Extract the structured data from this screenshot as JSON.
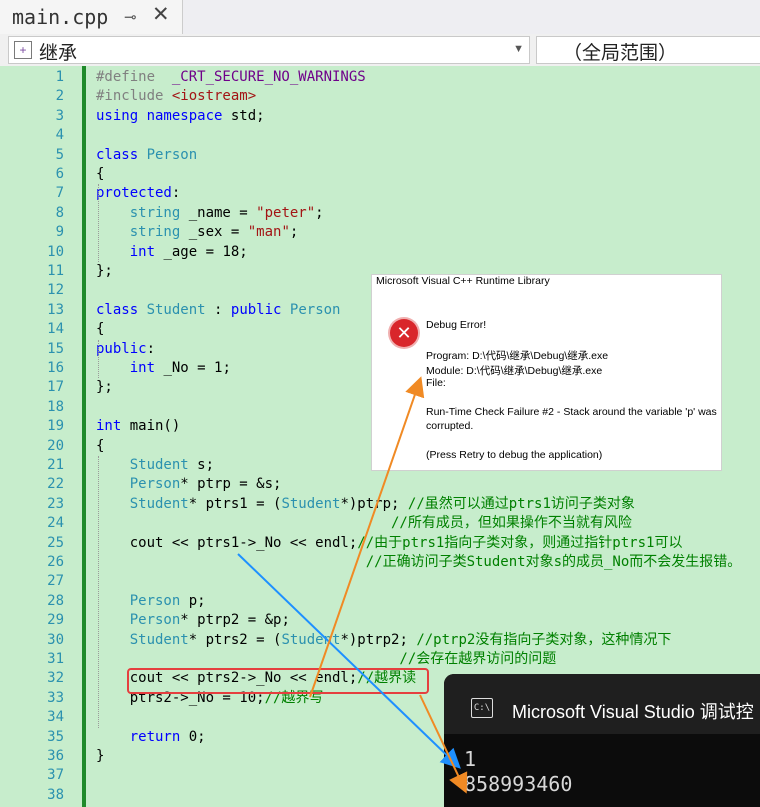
{
  "tab": {
    "title": "main.cpp",
    "pin_icon": "pin-icon",
    "close_icon": "close-icon"
  },
  "navbar": {
    "scope_label": "继承",
    "scope_icon": "class-scope-icon",
    "member_label": "（全局范围）"
  },
  "editor": {
    "line_numbers": [
      "1",
      "2",
      "3",
      "4",
      "5",
      "6",
      "7",
      "8",
      "9",
      "10",
      "11",
      "12",
      "13",
      "14",
      "15",
      "16",
      "17",
      "18",
      "19",
      "20",
      "21",
      "22",
      "23",
      "24",
      "25",
      "26",
      "27",
      "28",
      "29",
      "30",
      "31",
      "32",
      "33",
      "34",
      "35",
      "36",
      "37",
      "38"
    ],
    "lines": [
      [
        {
          "t": "#define  ",
          "c": "pp"
        },
        {
          "t": "_CRT_SECURE_NO_WARNINGS",
          "c": "mac"
        }
      ],
      [
        {
          "t": "#include ",
          "c": "pp"
        },
        {
          "t": "<iostream>",
          "c": "st"
        }
      ],
      [
        {
          "t": "using namespace ",
          "c": "kw"
        },
        {
          "t": "std;",
          "c": ""
        }
      ],
      [],
      [
        {
          "t": "class ",
          "c": "kw"
        },
        {
          "t": "Person",
          "c": "ty"
        }
      ],
      [
        {
          "t": "{",
          "c": ""
        }
      ],
      [
        {
          "t": "protected",
          "c": "kw"
        },
        {
          "t": ":",
          "c": ""
        }
      ],
      [
        {
          "t": "    string ",
          "c": "ty"
        },
        {
          "t": "_name = ",
          "c": ""
        },
        {
          "t": "\"peter\"",
          "c": "st"
        },
        {
          "t": ";",
          "c": ""
        }
      ],
      [
        {
          "t": "    string ",
          "c": "ty"
        },
        {
          "t": "_sex = ",
          "c": ""
        },
        {
          "t": "\"man\"",
          "c": "st"
        },
        {
          "t": ";",
          "c": ""
        }
      ],
      [
        {
          "t": "    int ",
          "c": "kw"
        },
        {
          "t": "_age = 18;",
          "c": ""
        }
      ],
      [
        {
          "t": "};",
          "c": ""
        }
      ],
      [],
      [
        {
          "t": "class ",
          "c": "kw"
        },
        {
          "t": "Student",
          "c": "ty"
        },
        {
          "t": " : ",
          "c": ""
        },
        {
          "t": "public ",
          "c": "kw"
        },
        {
          "t": "Person",
          "c": "ty"
        }
      ],
      [
        {
          "t": "{",
          "c": ""
        }
      ],
      [
        {
          "t": "public",
          "c": "kw"
        },
        {
          "t": ":",
          "c": ""
        }
      ],
      [
        {
          "t": "    int ",
          "c": "kw"
        },
        {
          "t": "_No = 1;",
          "c": ""
        }
      ],
      [
        {
          "t": "};",
          "c": ""
        }
      ],
      [],
      [
        {
          "t": "int ",
          "c": "kw"
        },
        {
          "t": "main()",
          "c": ""
        }
      ],
      [
        {
          "t": "{",
          "c": ""
        }
      ],
      [
        {
          "t": "    Student ",
          "c": "ty"
        },
        {
          "t": "s;",
          "c": ""
        }
      ],
      [
        {
          "t": "    Person",
          "c": "ty"
        },
        {
          "t": "* ptrp = &s;",
          "c": ""
        }
      ],
      [
        {
          "t": "    Student",
          "c": "ty"
        },
        {
          "t": "* ptrs1 = (",
          "c": ""
        },
        {
          "t": "Student",
          "c": "ty"
        },
        {
          "t": "*)ptrp; ",
          "c": ""
        },
        {
          "t": "//虽然可以通过ptrs1访问子类对象",
          "c": "cm"
        }
      ],
      [
        {
          "t": "                                   //所有成员，但如果操作不当就有风险",
          "c": "cm"
        }
      ],
      [
        {
          "t": "    cout << ptrs1->_No << endl;",
          "c": ""
        },
        {
          "t": "//由于ptrs1指向子类对象，则通过指针ptrs1可以",
          "c": "cm"
        }
      ],
      [
        {
          "t": "                                //正确访问子类Student对象s的成员_No而不会发生报错。",
          "c": "cm"
        }
      ],
      [],
      [
        {
          "t": "    Person ",
          "c": "ty"
        },
        {
          "t": "p;",
          "c": ""
        }
      ],
      [
        {
          "t": "    Person",
          "c": "ty"
        },
        {
          "t": "* ptrp2 = &p;",
          "c": ""
        }
      ],
      [
        {
          "t": "    Student",
          "c": "ty"
        },
        {
          "t": "* ptrs2 = (",
          "c": ""
        },
        {
          "t": "Student",
          "c": "ty"
        },
        {
          "t": "*)ptrp2; ",
          "c": ""
        },
        {
          "t": "//ptrp2没有指向子类对象，这种情况下",
          "c": "cm"
        }
      ],
      [
        {
          "t": "                                    //会存在越界访问的问题",
          "c": "cm"
        }
      ],
      [
        {
          "t": "    cout << ptrs2->_No << endl;",
          "c": ""
        },
        {
          "t": "//越界读",
          "c": "cm"
        }
      ],
      [
        {
          "t": "    ptrs2->_No = 10;",
          "c": ""
        },
        {
          "t": "//越界写",
          "c": "cm"
        }
      ],
      [],
      [
        {
          "t": "    return ",
          "c": "kw"
        },
        {
          "t": "0;",
          "c": ""
        }
      ],
      [
        {
          "t": "}",
          "c": ""
        }
      ],
      [],
      []
    ]
  },
  "dialog": {
    "title": "Microsoft Visual C++ Runtime Library",
    "icon": "error-icon",
    "heading": "Debug Error!",
    "program": "Program: D:\\代码\\继承\\Debug\\继承.exe",
    "module": "Module: D:\\代码\\继承\\Debug\\继承.exe",
    "file": "File:",
    "message_line1": "Run-Time Check Failure #2 - Stack around the variable 'p' was",
    "message_line2": "corrupted.",
    "hint": "(Press Retry to debug the application)"
  },
  "console": {
    "title": "Microsoft Visual Studio 调试控",
    "icon_label": "C:\\",
    "output": [
      "1",
      "858993460"
    ]
  },
  "annotation": {
    "box_color": "#e53f3f",
    "arrow_blue": "#1e90ff",
    "arrow_orange": "#f08a24"
  }
}
